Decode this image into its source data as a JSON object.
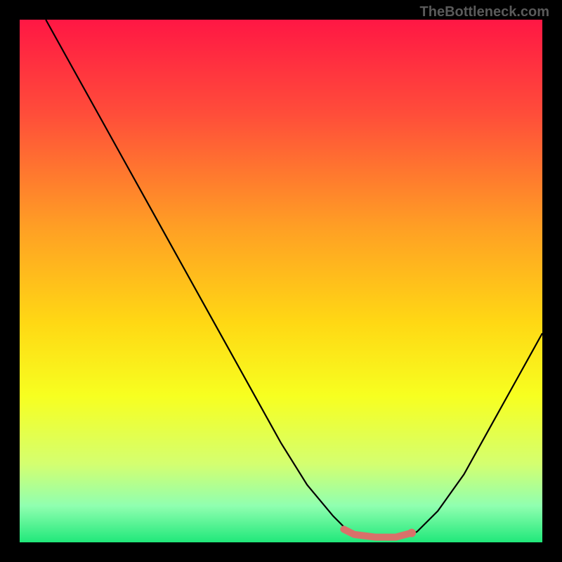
{
  "watermark": "TheBottleneck.com",
  "chart_data": {
    "type": "line",
    "title": "",
    "xlabel": "",
    "ylabel": "",
    "xlim": [
      0,
      100
    ],
    "ylim": [
      0,
      100
    ],
    "background_gradient": {
      "stops": [
        {
          "offset": 0,
          "color": "#ff1744"
        },
        {
          "offset": 18,
          "color": "#ff4d3a"
        },
        {
          "offset": 40,
          "color": "#ffa024"
        },
        {
          "offset": 58,
          "color": "#ffd814"
        },
        {
          "offset": 72,
          "color": "#f7ff20"
        },
        {
          "offset": 85,
          "color": "#d4ff70"
        },
        {
          "offset": 93,
          "color": "#90ffb0"
        },
        {
          "offset": 100,
          "color": "#20e87a"
        }
      ]
    },
    "curve": {
      "description": "V-shaped bottleneck curve with minimum around x≈70",
      "points": [
        {
          "x": 5,
          "y": 100
        },
        {
          "x": 10,
          "y": 91
        },
        {
          "x": 15,
          "y": 82
        },
        {
          "x": 20,
          "y": 73
        },
        {
          "x": 25,
          "y": 64
        },
        {
          "x": 30,
          "y": 55
        },
        {
          "x": 35,
          "y": 46
        },
        {
          "x": 40,
          "y": 37
        },
        {
          "x": 45,
          "y": 28
        },
        {
          "x": 50,
          "y": 19
        },
        {
          "x": 55,
          "y": 11
        },
        {
          "x": 60,
          "y": 5
        },
        {
          "x": 63,
          "y": 2
        },
        {
          "x": 68,
          "y": 1
        },
        {
          "x": 73,
          "y": 1
        },
        {
          "x": 76,
          "y": 2
        },
        {
          "x": 80,
          "y": 6
        },
        {
          "x": 85,
          "y": 13
        },
        {
          "x": 90,
          "y": 22
        },
        {
          "x": 95,
          "y": 31
        },
        {
          "x": 100,
          "y": 40
        }
      ]
    },
    "marker_segment": {
      "color": "#d9716a",
      "points": [
        {
          "x": 62,
          "y": 2.5
        },
        {
          "x": 64,
          "y": 1.5
        },
        {
          "x": 68,
          "y": 1
        },
        {
          "x": 72,
          "y": 1
        },
        {
          "x": 75,
          "y": 1.8
        }
      ],
      "end_dot": {
        "x": 75,
        "y": 1.8
      }
    }
  }
}
